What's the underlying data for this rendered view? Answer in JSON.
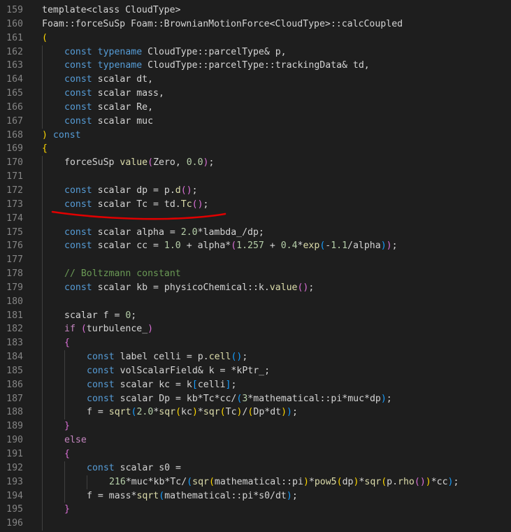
{
  "editor": {
    "theme_colors": {
      "background": "#1e1e1e",
      "line_number": "#858585",
      "text": "#d4d4d4",
      "keyword": "#569cd6",
      "control": "#c586c0",
      "function": "#dcdcaa",
      "number": "#b5cea8",
      "comment": "#6a9955",
      "bracket_1": "#ffd700",
      "bracket_2": "#da70d6",
      "bracket_3": "#179fff",
      "annotation": "#e00000"
    },
    "lines": [
      {
        "n": "159",
        "indent": 0,
        "tokens": [
          [
            "pl",
            "template<class CloudType>"
          ]
        ]
      },
      {
        "n": "160",
        "indent": 0,
        "tokens": [
          [
            "pl",
            "Foam::forceSuSp Foam::BrownianMotionForce<CloudType>::calcCoupled"
          ]
        ]
      },
      {
        "n": "161",
        "indent": 0,
        "tokens": [
          [
            "b1",
            "("
          ]
        ]
      },
      {
        "n": "162",
        "indent": 1,
        "tokens": [
          [
            "kw",
            "const"
          ],
          [
            "pl",
            " "
          ],
          [
            "kw",
            "typename"
          ],
          [
            "pl",
            " CloudType::parcelType& p,"
          ]
        ]
      },
      {
        "n": "163",
        "indent": 1,
        "tokens": [
          [
            "kw",
            "const"
          ],
          [
            "pl",
            " "
          ],
          [
            "kw",
            "typename"
          ],
          [
            "pl",
            " CloudType::parcelType::trackingData& td,"
          ]
        ]
      },
      {
        "n": "164",
        "indent": 1,
        "tokens": [
          [
            "kw",
            "const"
          ],
          [
            "pl",
            " scalar dt,"
          ]
        ]
      },
      {
        "n": "165",
        "indent": 1,
        "tokens": [
          [
            "kw",
            "const"
          ],
          [
            "pl",
            " scalar mass,"
          ]
        ]
      },
      {
        "n": "166",
        "indent": 1,
        "tokens": [
          [
            "kw",
            "const"
          ],
          [
            "pl",
            " scalar Re,"
          ]
        ]
      },
      {
        "n": "167",
        "indent": 1,
        "tokens": [
          [
            "kw",
            "const"
          ],
          [
            "pl",
            " scalar muc"
          ]
        ]
      },
      {
        "n": "168",
        "indent": 0,
        "tokens": [
          [
            "b1",
            ")"
          ],
          [
            "pl",
            " "
          ],
          [
            "kw",
            "const"
          ]
        ]
      },
      {
        "n": "169",
        "indent": 0,
        "tokens": [
          [
            "b1",
            "{"
          ]
        ]
      },
      {
        "n": "170",
        "indent": 1,
        "tokens": [
          [
            "pl",
            "forceSuSp "
          ],
          [
            "fn",
            "value"
          ],
          [
            "b2",
            "("
          ],
          [
            "pl",
            "Zero, "
          ],
          [
            "num",
            "0.0"
          ],
          [
            "b2",
            ")"
          ],
          [
            "pl",
            ";"
          ]
        ]
      },
      {
        "n": "171",
        "indent": 1,
        "tokens": []
      },
      {
        "n": "172",
        "indent": 1,
        "tokens": [
          [
            "kw",
            "const"
          ],
          [
            "pl",
            " scalar dp = p."
          ],
          [
            "fn",
            "d"
          ],
          [
            "b2",
            "()"
          ],
          [
            "pl",
            ";"
          ]
        ]
      },
      {
        "n": "173",
        "indent": 1,
        "tokens": [
          [
            "kw",
            "const"
          ],
          [
            "pl",
            " scalar Tc = td."
          ],
          [
            "fn",
            "Tc"
          ],
          [
            "b2",
            "()"
          ],
          [
            "pl",
            ";"
          ]
        ]
      },
      {
        "n": "174",
        "indent": 1,
        "tokens": []
      },
      {
        "n": "175",
        "indent": 1,
        "tokens": [
          [
            "kw",
            "const"
          ],
          [
            "pl",
            " scalar alpha = "
          ],
          [
            "num",
            "2.0"
          ],
          [
            "pl",
            "*lambda_/dp;"
          ]
        ]
      },
      {
        "n": "176",
        "indent": 1,
        "tokens": [
          [
            "kw",
            "const"
          ],
          [
            "pl",
            " scalar cc = "
          ],
          [
            "num",
            "1.0"
          ],
          [
            "pl",
            " + alpha*"
          ],
          [
            "b2",
            "("
          ],
          [
            "num",
            "1.257"
          ],
          [
            "pl",
            " + "
          ],
          [
            "num",
            "0.4"
          ],
          [
            "pl",
            "*"
          ],
          [
            "fn",
            "exp"
          ],
          [
            "b3",
            "("
          ],
          [
            "pl",
            "-"
          ],
          [
            "num",
            "1.1"
          ],
          [
            "pl",
            "/alpha"
          ],
          [
            "b3",
            ")"
          ],
          [
            "b2",
            ")"
          ],
          [
            "pl",
            ";"
          ]
        ]
      },
      {
        "n": "177",
        "indent": 1,
        "tokens": []
      },
      {
        "n": "178",
        "indent": 1,
        "tokens": [
          [
            "cm",
            "// Boltzmann constant"
          ]
        ]
      },
      {
        "n": "179",
        "indent": 1,
        "tokens": [
          [
            "kw",
            "const"
          ],
          [
            "pl",
            " scalar kb = physicoChemical::k."
          ],
          [
            "fn",
            "value"
          ],
          [
            "b2",
            "()"
          ],
          [
            "pl",
            ";"
          ]
        ]
      },
      {
        "n": "180",
        "indent": 1,
        "tokens": []
      },
      {
        "n": "181",
        "indent": 1,
        "tokens": [
          [
            "pl",
            "scalar f = "
          ],
          [
            "num",
            "0"
          ],
          [
            "pl",
            ";"
          ]
        ]
      },
      {
        "n": "182",
        "indent": 1,
        "tokens": [
          [
            "ctl",
            "if"
          ],
          [
            "pl",
            " "
          ],
          [
            "b2",
            "("
          ],
          [
            "pl",
            "turbulence_"
          ],
          [
            "b2",
            ")"
          ]
        ]
      },
      {
        "n": "183",
        "indent": 1,
        "tokens": [
          [
            "b2",
            "{"
          ]
        ]
      },
      {
        "n": "184",
        "indent": 2,
        "tokens": [
          [
            "kw",
            "const"
          ],
          [
            "pl",
            " label celli = p."
          ],
          [
            "fn",
            "cell"
          ],
          [
            "b3",
            "()"
          ],
          [
            "pl",
            ";"
          ]
        ]
      },
      {
        "n": "185",
        "indent": 2,
        "tokens": [
          [
            "kw",
            "const"
          ],
          [
            "pl",
            " volScalarField& k = *kPtr_;"
          ]
        ]
      },
      {
        "n": "186",
        "indent": 2,
        "tokens": [
          [
            "kw",
            "const"
          ],
          [
            "pl",
            " scalar kc = k"
          ],
          [
            "b3",
            "["
          ],
          [
            "pl",
            "celli"
          ],
          [
            "b3",
            "]"
          ],
          [
            "pl",
            ";"
          ]
        ]
      },
      {
        "n": "187",
        "indent": 2,
        "tokens": [
          [
            "kw",
            "const"
          ],
          [
            "pl",
            " scalar Dp = kb*Tc*cc/"
          ],
          [
            "b3",
            "("
          ],
          [
            "num",
            "3"
          ],
          [
            "pl",
            "*mathematical::pi*muc*dp"
          ],
          [
            "b3",
            ")"
          ],
          [
            "pl",
            ";"
          ]
        ]
      },
      {
        "n": "188",
        "indent": 2,
        "tokens": [
          [
            "pl",
            "f = "
          ],
          [
            "fn",
            "sqrt"
          ],
          [
            "b3",
            "("
          ],
          [
            "num",
            "2.0"
          ],
          [
            "pl",
            "*"
          ],
          [
            "fn",
            "sqr"
          ],
          [
            "b1",
            "("
          ],
          [
            "pl",
            "kc"
          ],
          [
            "b1",
            ")"
          ],
          [
            "pl",
            "*"
          ],
          [
            "fn",
            "sqr"
          ],
          [
            "b1",
            "("
          ],
          [
            "pl",
            "Tc"
          ],
          [
            "b1",
            ")"
          ],
          [
            "pl",
            "/"
          ],
          [
            "b1",
            "("
          ],
          [
            "pl",
            "Dp*dt"
          ],
          [
            "b1",
            ")"
          ],
          [
            "b3",
            ")"
          ],
          [
            "pl",
            ";"
          ]
        ]
      },
      {
        "n": "189",
        "indent": 1,
        "tokens": [
          [
            "b2",
            "}"
          ]
        ]
      },
      {
        "n": "190",
        "indent": 1,
        "tokens": [
          [
            "ctl",
            "else"
          ]
        ]
      },
      {
        "n": "191",
        "indent": 1,
        "tokens": [
          [
            "b2",
            "{"
          ]
        ]
      },
      {
        "n": "192",
        "indent": 2,
        "tokens": [
          [
            "kw",
            "const"
          ],
          [
            "pl",
            " scalar s0 ="
          ]
        ]
      },
      {
        "n": "193",
        "indent": 3,
        "tokens": [
          [
            "num",
            "216"
          ],
          [
            "pl",
            "*muc*kb*Tc/"
          ],
          [
            "b3",
            "("
          ],
          [
            "fn",
            "sqr"
          ],
          [
            "b1",
            "("
          ],
          [
            "pl",
            "mathematical::pi"
          ],
          [
            "b1",
            ")"
          ],
          [
            "pl",
            "*"
          ],
          [
            "fn",
            "pow5"
          ],
          [
            "b1",
            "("
          ],
          [
            "pl",
            "dp"
          ],
          [
            "b1",
            ")"
          ],
          [
            "pl",
            "*"
          ],
          [
            "fn",
            "sqr"
          ],
          [
            "b1",
            "("
          ],
          [
            "pl",
            "p."
          ],
          [
            "fn",
            "rho"
          ],
          [
            "b2",
            "()"
          ],
          [
            "b1",
            ")"
          ],
          [
            "pl",
            "*cc"
          ],
          [
            "b3",
            ")"
          ],
          [
            "pl",
            ";"
          ]
        ]
      },
      {
        "n": "194",
        "indent": 2,
        "tokens": [
          [
            "pl",
            "f = mass*"
          ],
          [
            "fn",
            "sqrt"
          ],
          [
            "b3",
            "("
          ],
          [
            "pl",
            "mathematical::pi*s0/dt"
          ],
          [
            "b3",
            ")"
          ],
          [
            "pl",
            ";"
          ]
        ]
      },
      {
        "n": "195",
        "indent": 1,
        "tokens": [
          [
            "b2",
            "}"
          ]
        ]
      },
      {
        "n": "196",
        "indent": 1,
        "tokens": []
      }
    ]
  },
  "annotation": {
    "kind": "hand-drawn underline",
    "target_line": "173",
    "color": "#e00000"
  }
}
